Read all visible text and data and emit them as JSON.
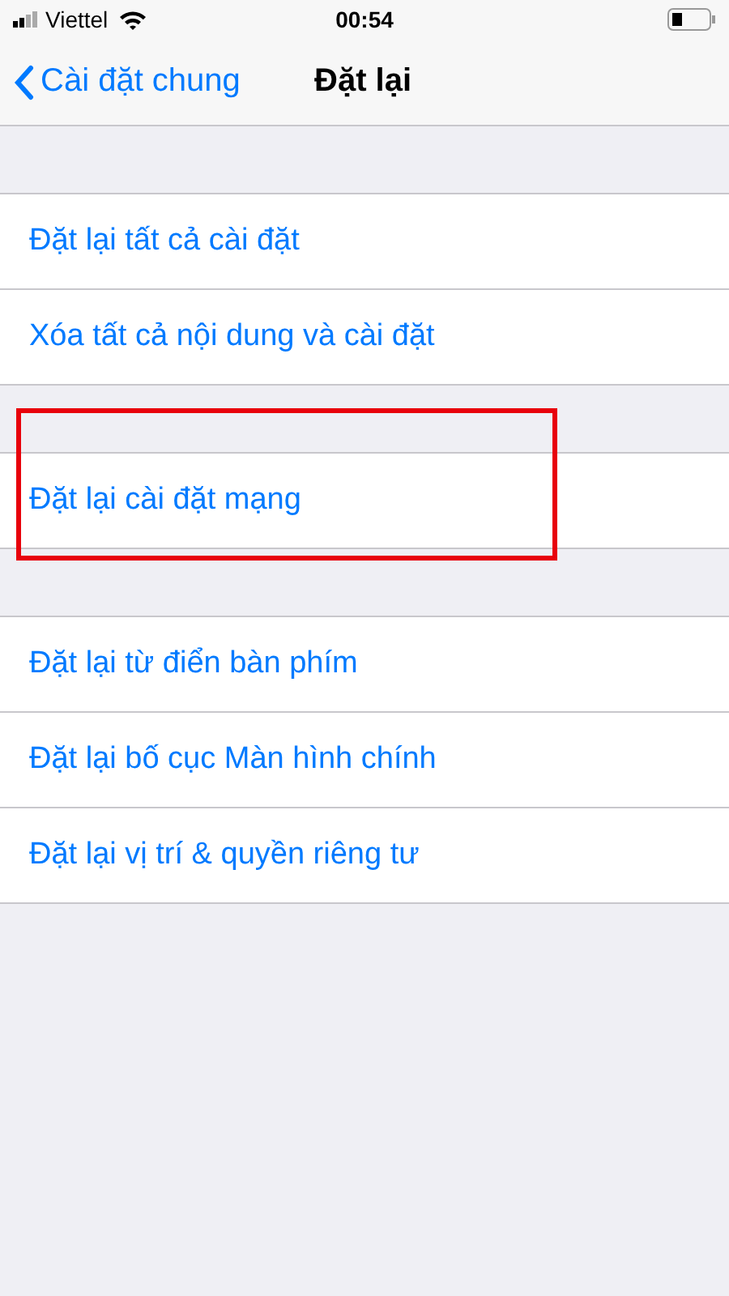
{
  "status_bar": {
    "carrier": "Viettel",
    "time": "00:54"
  },
  "nav_bar": {
    "back": "Cài đặt chung",
    "title": "Đặt lại"
  },
  "groups": [
    {
      "items": [
        {
          "label": "Đặt lại tất cả cài đặt",
          "highlighted": false
        },
        {
          "label": "Xóa tất cả nội dung và cài đặt",
          "highlighted": false
        }
      ]
    },
    {
      "items": [
        {
          "label": "Đặt lại cài đặt mạng",
          "highlighted": true
        }
      ]
    },
    {
      "items": [
        {
          "label": "Đặt lại từ điển bàn phím",
          "highlighted": false
        },
        {
          "label": "Đặt lại bố cục Màn hình chính",
          "highlighted": false
        },
        {
          "label": "Đặt lại vị trí & quyền riêng tư",
          "highlighted": false
        }
      ]
    }
  ]
}
